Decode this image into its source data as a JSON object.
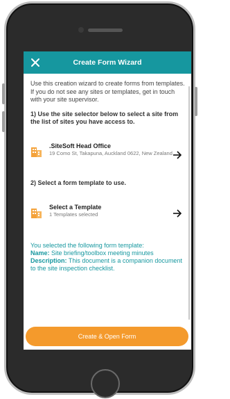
{
  "header": {
    "title": "Create Form Wizard",
    "close_icon": "close-icon"
  },
  "intro": "Use this creation wizard to create forms from templates. If you do not see any sites or templates, get in touch with your site supervisor.",
  "step1": "1) Use the site selector below to select a site from the list of sites you have access to.",
  "site": {
    "name": ".SiteSoft Head Office",
    "address": "19 Como St, Takapuna, Auckland 0622, New Zealand",
    "icon": "building-icon",
    "action_icon": "arrow-right-icon"
  },
  "step2": "2) Select a form template to use.",
  "template": {
    "title": "Select a Template",
    "count": "1 Templates selected",
    "icon": "building-icon",
    "action_icon": "arrow-right-icon"
  },
  "selection": {
    "intro": "You selected the following form template:",
    "name_label": "Name:",
    "name_value": "Site briefing/toolbox meeting minutes",
    "desc_label": "Description:",
    "desc_value": "This document is a companion document to the site inspection checklist."
  },
  "footer": {
    "button_label": "Create & Open Form"
  },
  "colors": {
    "accent": "#16979f",
    "button": "#f49a2c",
    "icon": "#f4a23a"
  }
}
